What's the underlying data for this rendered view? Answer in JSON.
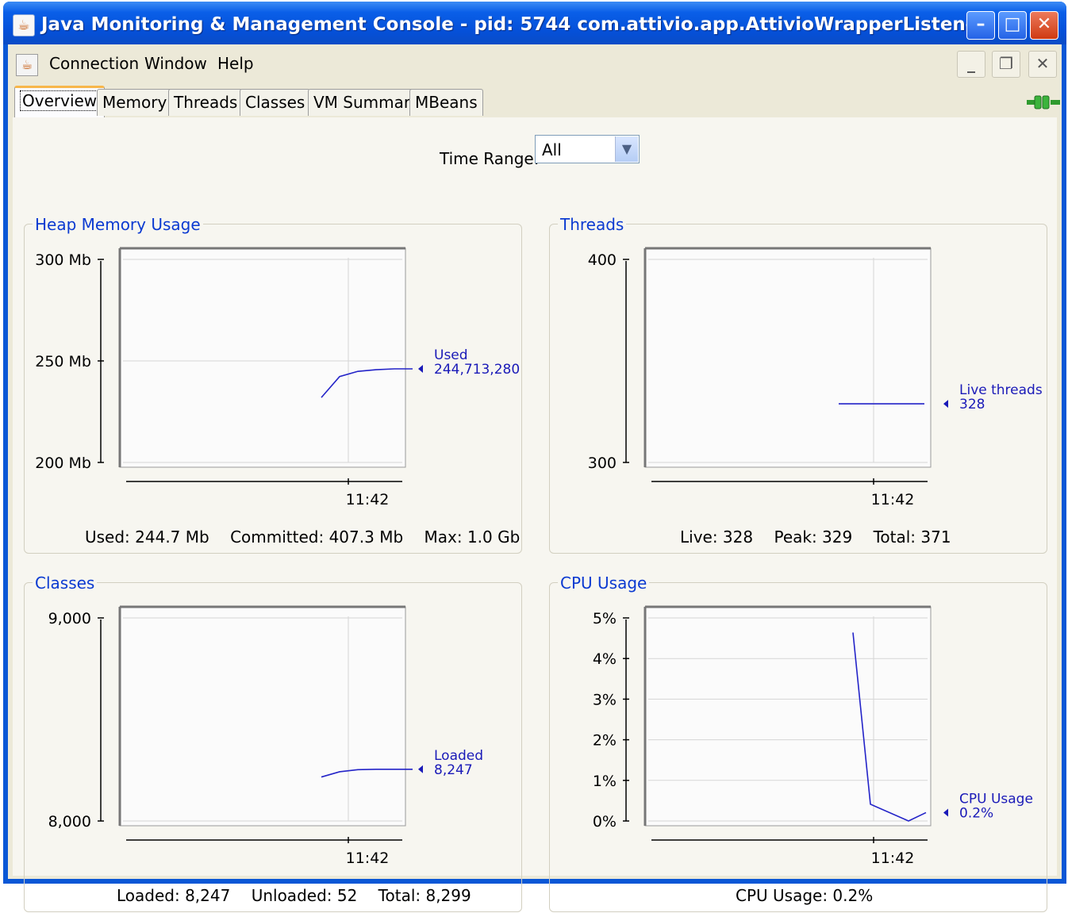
{
  "window": {
    "title": "Java Monitoring & Management Console - pid: 5744 com.attivio.app.AttivioWrapperListener",
    "controls": [
      "minimize-button",
      "maximize-button",
      "close-button"
    ]
  },
  "menu": {
    "items": [
      {
        "label": "Connection"
      },
      {
        "label": "Window"
      },
      {
        "label": "Help"
      }
    ]
  },
  "tabs": [
    {
      "label": "Overview",
      "active": true
    },
    {
      "label": "Memory"
    },
    {
      "label": "Threads"
    },
    {
      "label": "Classes"
    },
    {
      "label": "VM Summary"
    },
    {
      "label": "MBeans"
    }
  ],
  "time_range": {
    "label": "Time Range:",
    "value": "All"
  },
  "panels": {
    "heap": {
      "title": "Heap Memory Usage",
      "summary": [
        "Used: 244.7 Mb",
        "Committed: 407.3 Mb",
        "Max: 1.0 Gb"
      ]
    },
    "threads": {
      "title": "Threads",
      "summary": [
        "Live: 328",
        "Peak: 329",
        "Total: 371"
      ]
    },
    "classes": {
      "title": "Classes",
      "summary": [
        "Loaded: 8,247",
        "Unloaded: 52",
        "Total: 8,299"
      ]
    },
    "cpu": {
      "title": "CPU Usage",
      "summary": [
        "CPU Usage: 0.2%"
      ]
    }
  },
  "chart_data": [
    {
      "type": "line",
      "id": "heap",
      "y_ticks": [
        "300 Mb",
        "250 Mb",
        "200 Mb"
      ],
      "ylim": [
        200,
        300
      ],
      "x_ticks": [
        "11:42"
      ],
      "series": [
        {
          "name": "Used",
          "value_label": "244,713,280",
          "values": [
            231,
            241,
            243.5,
            244.3,
            244.7,
            244.7
          ]
        }
      ]
    },
    {
      "type": "line",
      "id": "threads",
      "y_ticks": [
        "400",
        "300"
      ],
      "ylim": [
        300,
        400
      ],
      "x_ticks": [
        "11:42"
      ],
      "series": [
        {
          "name": "Live threads",
          "value_label": "328",
          "values": [
            328,
            328,
            328
          ]
        }
      ]
    },
    {
      "type": "line",
      "id": "classes",
      "y_ticks": [
        "9,000",
        "8,000"
      ],
      "ylim": [
        8000,
        9000
      ],
      "x_ticks": [
        "11:42"
      ],
      "series": [
        {
          "name": "Loaded",
          "value_label": "8,247",
          "values": [
            8210,
            8235,
            8245,
            8247,
            8247,
            8247
          ]
        }
      ]
    },
    {
      "type": "line",
      "id": "cpu",
      "y_ticks": [
        "5%",
        "4%",
        "3%",
        "2%",
        "1%",
        "0%"
      ],
      "ylim": [
        0,
        5
      ],
      "x_ticks": [
        "11:42"
      ],
      "series": [
        {
          "name": "CPU Usage",
          "value_label": "0.2%",
          "values": [
            4.5,
            0.4,
            0.0,
            0.2
          ]
        }
      ]
    }
  ]
}
